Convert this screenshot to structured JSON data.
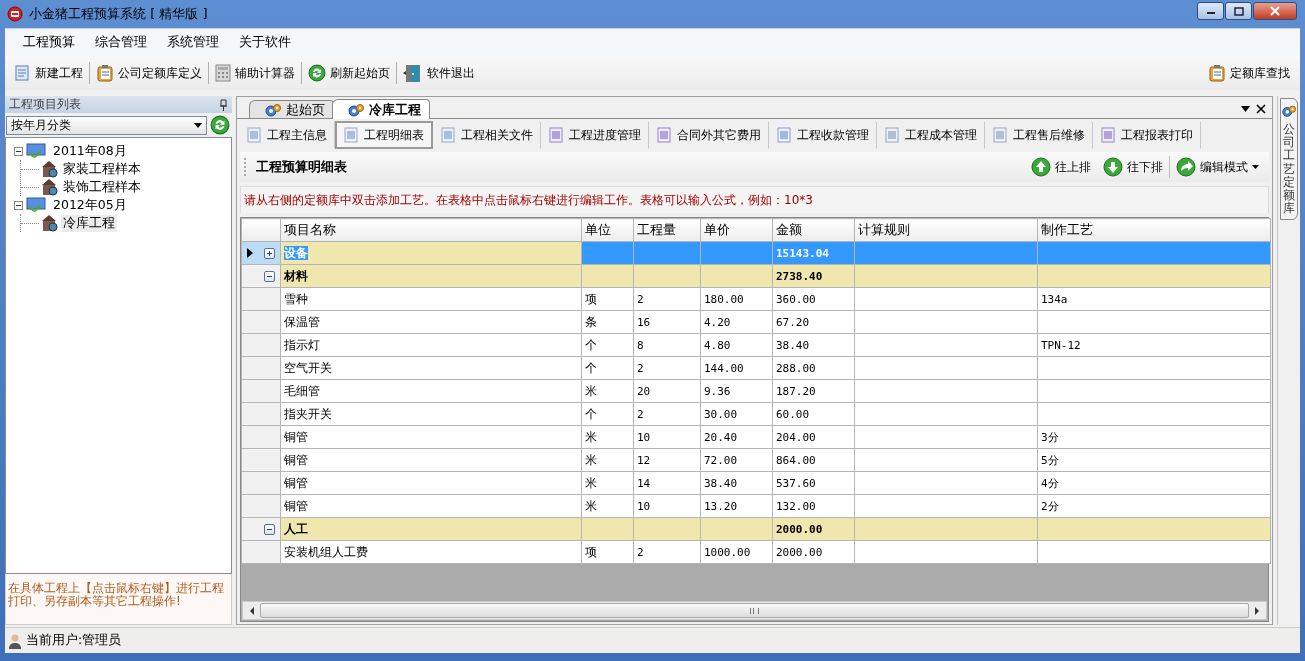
{
  "window": {
    "title": "小金猪工程预算系统 [ 精华版 ]"
  },
  "menu": [
    {
      "label": "工程预算"
    },
    {
      "label": "综合管理"
    },
    {
      "label": "系统管理"
    },
    {
      "label": "关于软件"
    }
  ],
  "toolbar": [
    {
      "label": "新建工程"
    },
    {
      "label": "公司定额库定义"
    },
    {
      "label": "辅助计算器"
    },
    {
      "label": "刷新起始页"
    },
    {
      "label": "软件退出"
    }
  ],
  "toolbar_right": {
    "label": "定额库查找"
  },
  "left_panel": {
    "title": "工程项目列表",
    "filter": {
      "value": "按年月分类"
    },
    "tree": [
      {
        "label": "2011年08月",
        "expanded": true,
        "children": [
          {
            "label": "家装工程样本",
            "selected": false
          },
          {
            "label": "装饰工程样本",
            "selected": false
          }
        ]
      },
      {
        "label": "2012年05月",
        "expanded": true,
        "children": [
          {
            "label": "冷库工程",
            "selected": true
          }
        ]
      }
    ],
    "hint": "在具体工程上【点击鼠标右键】进行工程打印、另存副本等其它工程操作!"
  },
  "tabs": [
    {
      "label": "起始页",
      "selected": false
    },
    {
      "label": "冷库工程",
      "selected": true
    }
  ],
  "sub_tabs": [
    {
      "label": "工程主信息",
      "selected": false
    },
    {
      "label": "工程明细表",
      "selected": true
    },
    {
      "label": "工程相关文件",
      "selected": false
    },
    {
      "label": "工程进度管理",
      "selected": false
    },
    {
      "label": "合同外其它费用",
      "selected": false
    },
    {
      "label": "工程收款管理",
      "selected": false
    },
    {
      "label": "工程成本管理",
      "selected": false
    },
    {
      "label": "工程售后维修",
      "selected": false
    },
    {
      "label": "工程报表打印",
      "selected": false
    }
  ],
  "section_title": "工程预算明细表",
  "actions": [
    {
      "label": "往上排"
    },
    {
      "label": "往下排"
    },
    {
      "label": "编辑模式"
    }
  ],
  "notice": "请从右侧的定额库中双击添加工艺。在表格中点击鼠标右键进行编辑工作。表格可以输入公式，例如：10*3",
  "table": {
    "columns": [
      "项目名称",
      "单位",
      "工程量",
      "单价",
      "金额",
      "计算规则",
      "制作工艺"
    ],
    "rows": [
      {
        "kind": "group",
        "name": "设备",
        "amount": "15143.04",
        "expanded": false,
        "selected": true
      },
      {
        "kind": "group",
        "name": "材料",
        "amount": "2738.40",
        "expanded": true,
        "selected": false
      },
      {
        "kind": "item",
        "name": "雪种",
        "unit": "项",
        "quantity": "2",
        "price": "180.00",
        "amount": "360.00",
        "craft": "134a",
        "selected": false
      },
      {
        "kind": "item",
        "name": "保温管",
        "unit": "条",
        "quantity": "16",
        "price": "4.20",
        "amount": "67.20",
        "selected": false
      },
      {
        "kind": "item",
        "name": "指示灯",
        "unit": "个",
        "quantity": "8",
        "price": "4.80",
        "amount": "38.40",
        "craft": "TPN-12",
        "selected": false
      },
      {
        "kind": "item",
        "name": "空气开关",
        "unit": "个",
        "quantity": "2",
        "price": "144.00",
        "amount": "288.00",
        "selected": false
      },
      {
        "kind": "item",
        "name": "毛细管",
        "unit": "米",
        "quantity": "20",
        "price": "9.36",
        "amount": "187.20",
        "selected": false
      },
      {
        "kind": "item",
        "name": "指夹开关",
        "unit": "个",
        "quantity": "2",
        "price": "30.00",
        "amount": "60.00",
        "selected": false
      },
      {
        "kind": "item",
        "name": "铜管",
        "unit": "米",
        "quantity": "10",
        "price": "20.40",
        "amount": "204.00",
        "craft": "3分",
        "selected": false
      },
      {
        "kind": "item",
        "name": "铜管",
        "unit": "米",
        "quantity": "12",
        "price": "72.00",
        "amount": "864.00",
        "craft": "5分",
        "selected": false
      },
      {
        "kind": "item",
        "name": "铜管",
        "unit": "米",
        "quantity": "14",
        "price": "38.40",
        "amount": "537.60",
        "craft": "4分",
        "selected": false
      },
      {
        "kind": "item",
        "name": "铜管",
        "unit": "米",
        "quantity": "10",
        "price": "13.20",
        "amount": "132.00",
        "craft": "2分",
        "selected": false
      },
      {
        "kind": "group",
        "name": "人工",
        "amount": "2000.00",
        "expanded": true,
        "selected": false
      },
      {
        "kind": "item",
        "name": "安装机组人工费",
        "unit": "项",
        "quantity": "2",
        "price": "1000.00",
        "amount": "2000.00",
        "selected": false
      }
    ]
  },
  "side_tab": {
    "label": "公司工艺定额库"
  },
  "status": {
    "user": "当前用户:管理员"
  }
}
